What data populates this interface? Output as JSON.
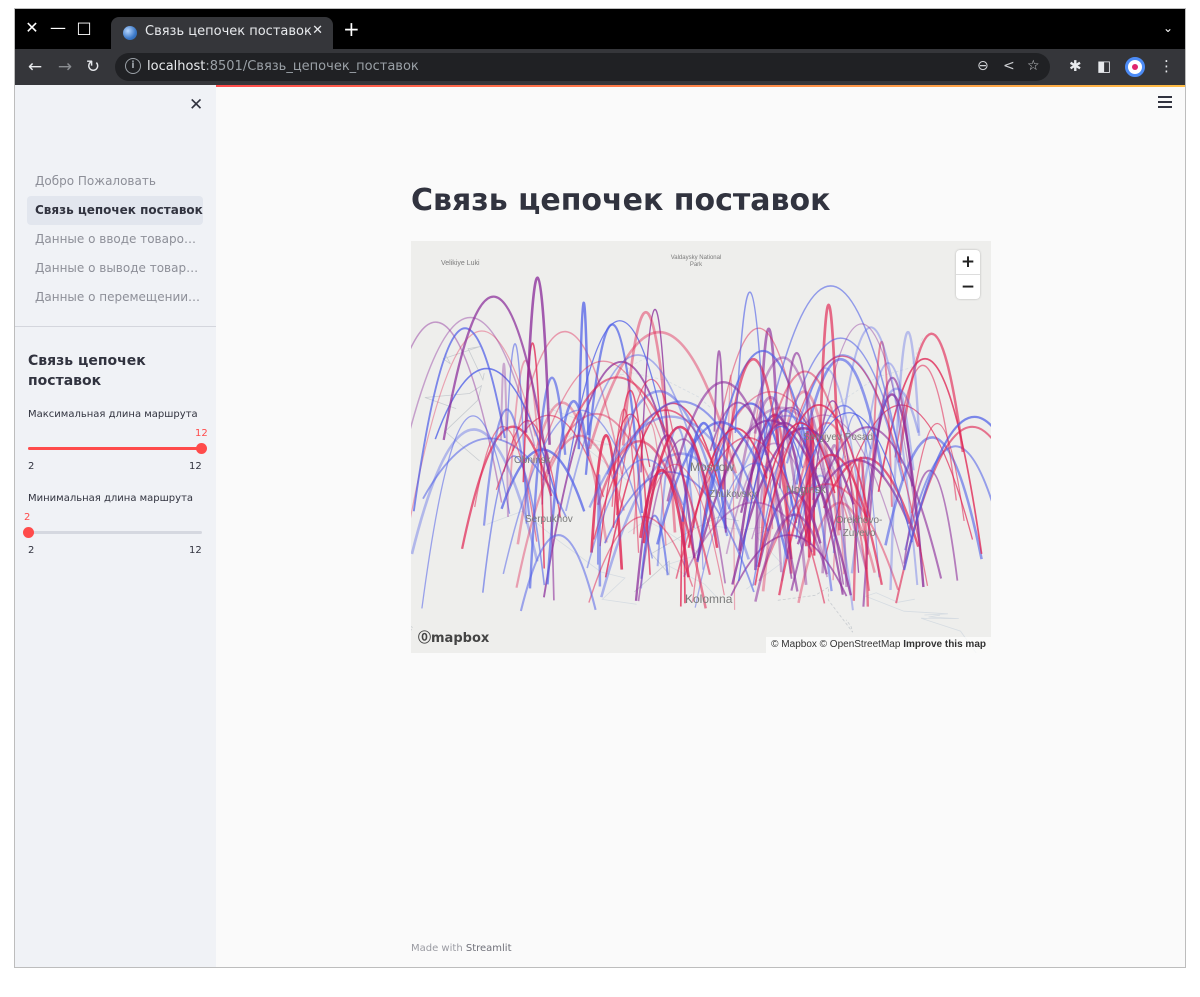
{
  "browser": {
    "tab_title": "Связь цепочек поставок",
    "url_host": "localhost",
    "url_path": ":8501/Связь_цепочек_поставок"
  },
  "sidebar": {
    "nav": [
      "Добро Пожаловать",
      "Связь цепочек поставок",
      "Данные о вводе товаров ...",
      "Данные о выводе товаро...",
      "Данные о перемещении т..."
    ],
    "section_title": "Связь цепочек поставок",
    "max_route": {
      "label": "Максимальная длина маршрута",
      "value": "12",
      "min": "2",
      "max": "12"
    },
    "min_route": {
      "label": "Минимальная длина маршрута",
      "value": "2",
      "min": "2",
      "max": "12"
    }
  },
  "page": {
    "title": "Связь цепочек поставок"
  },
  "map": {
    "cities": [
      "Velikiye Luki",
      "Valdaysky National Park",
      "Obninsk",
      "Moscow",
      "Zhukovsky",
      "Noginsk",
      "Sergiyev Posad",
      "Serpukhov",
      "Orekhovo-Zuyevo",
      "Kolomna"
    ],
    "logo": "mapbox",
    "attribution": "© Mapbox © OpenStreetMap",
    "improve_link": "Improve this map",
    "zoom_in": "+",
    "zoom_out": "−",
    "arc_colors": [
      "#e0204f",
      "#4f5fe8",
      "#8b2d9b"
    ]
  },
  "footer": {
    "made_with": "Made with",
    "brand": "Streamlit"
  }
}
